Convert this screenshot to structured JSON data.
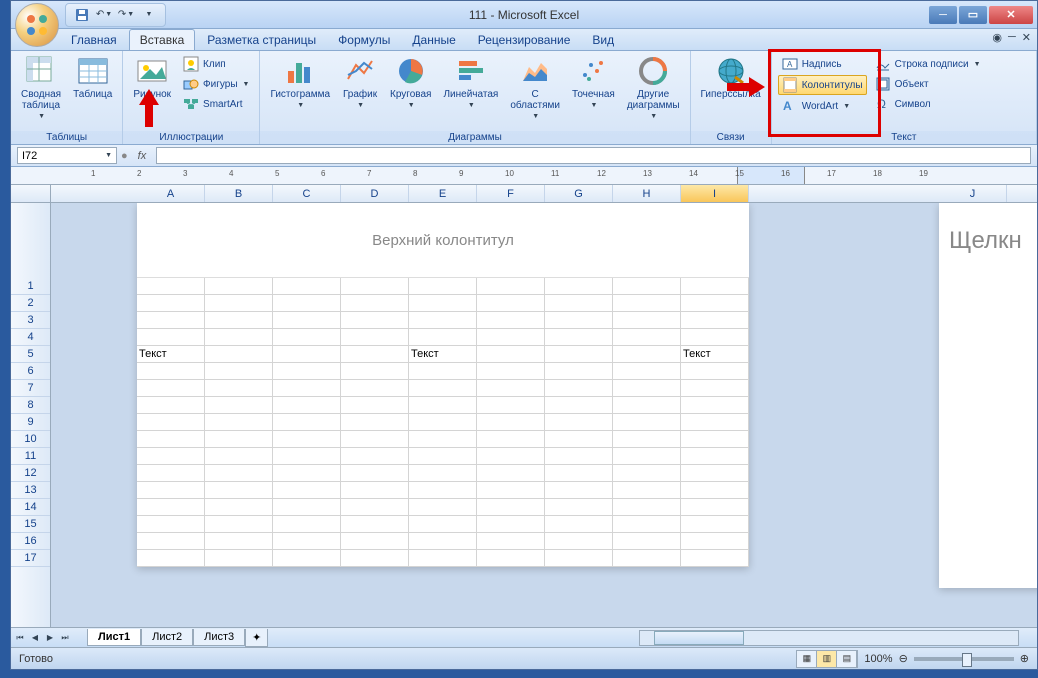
{
  "title": "111 - Microsoft Excel",
  "qat": {
    "save": "save-icon",
    "undo": "undo-icon",
    "redo": "redo-icon"
  },
  "tabs": [
    "Главная",
    "Вставка",
    "Разметка страницы",
    "Формулы",
    "Данные",
    "Рецензирование",
    "Вид"
  ],
  "active_tab": 1,
  "ribbon": {
    "tables": {
      "label": "Таблицы",
      "pivot": "Сводная\nтаблица",
      "table": "Таблица"
    },
    "illustrations": {
      "label": "Иллюстрации",
      "picture": "Рисунок",
      "clip": "Клип",
      "shapes": "Фигуры",
      "smartart": "SmartArt"
    },
    "charts": {
      "label": "Диаграммы",
      "column": "Гистограмма",
      "line": "График",
      "pie": "Круговая",
      "bar": "Линейчатая",
      "area": "С\nобластями",
      "scatter": "Точечная",
      "other": "Другие\nдиаграммы"
    },
    "links": {
      "label": "Связи",
      "hyperlink": "Гиперссылка"
    },
    "text": {
      "label": "Текст",
      "textbox": "Надпись",
      "header_footer": "Колонтитулы",
      "wordart": "WordArt",
      "signature": "Строка подписи",
      "object": "Объект",
      "symbol": "Символ"
    }
  },
  "name_box": "I72",
  "fx": "fx",
  "ruler_marks": [
    "1",
    "2",
    "3",
    "4",
    "5",
    "6",
    "7",
    "8",
    "9",
    "10",
    "11",
    "12",
    "13",
    "14",
    "15",
    "16",
    "17",
    "18",
    "19"
  ],
  "columns": [
    "A",
    "B",
    "C",
    "D",
    "E",
    "F",
    "G",
    "H",
    "I",
    "J"
  ],
  "selected_col": "I",
  "rows": [
    "1",
    "2",
    "3",
    "4",
    "5",
    "6",
    "7",
    "8",
    "9",
    "10",
    "11",
    "12",
    "13",
    "14",
    "15",
    "16",
    "17"
  ],
  "page_header_text": "Верхний колонтитул",
  "page2_text": "Щелкн",
  "cell_data": {
    "row5": {
      "A": "Текст",
      "E": "Текст",
      "I": "Текст"
    }
  },
  "sheet_tabs": [
    "Лист1",
    "Лист2",
    "Лист3"
  ],
  "active_sheet": 0,
  "status": "Готово",
  "zoom": "100%"
}
